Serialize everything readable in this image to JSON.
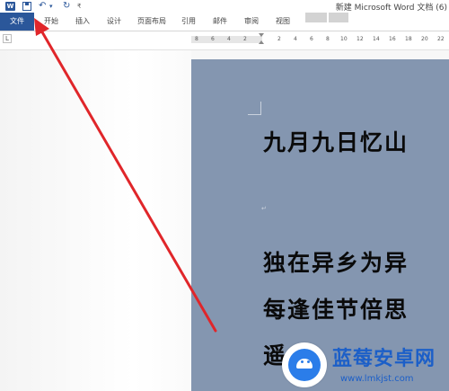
{
  "window": {
    "app_icon": "W",
    "title": "新建 Microsoft Word 文档 (6)"
  },
  "quick_access": {
    "save_icon": "save-icon",
    "undo_glyph": "↶",
    "dropdown_glyph": "▾",
    "redo_glyph": "↻",
    "customize_glyph": "₹"
  },
  "ribbon": {
    "file_tab": "文件",
    "tabs": [
      "开始",
      "插入",
      "设计",
      "页面布局",
      "引用",
      "邮件",
      "审阅",
      "视图"
    ],
    "accent_color": "#2b579a"
  },
  "ruler": {
    "tab_selector": "L",
    "left_numbers": [
      "8",
      "6",
      "4",
      "2"
    ],
    "right_numbers": [
      "2",
      "4",
      "6",
      "8",
      "10",
      "12",
      "14",
      "16",
      "18",
      "20",
      "22"
    ]
  },
  "document": {
    "page_color": "#8496b0",
    "paragraph_mark": "↵",
    "lines": [
      "九月九日忆山",
      "独在异乡为异",
      "每逢佳节倍思",
      "遥"
    ]
  },
  "watermark": {
    "title": "蓝莓安卓网",
    "url": "www.lmkjst.com",
    "color": "#1c5fc8"
  },
  "annotation": {
    "arrow_color": "#e0262a"
  }
}
